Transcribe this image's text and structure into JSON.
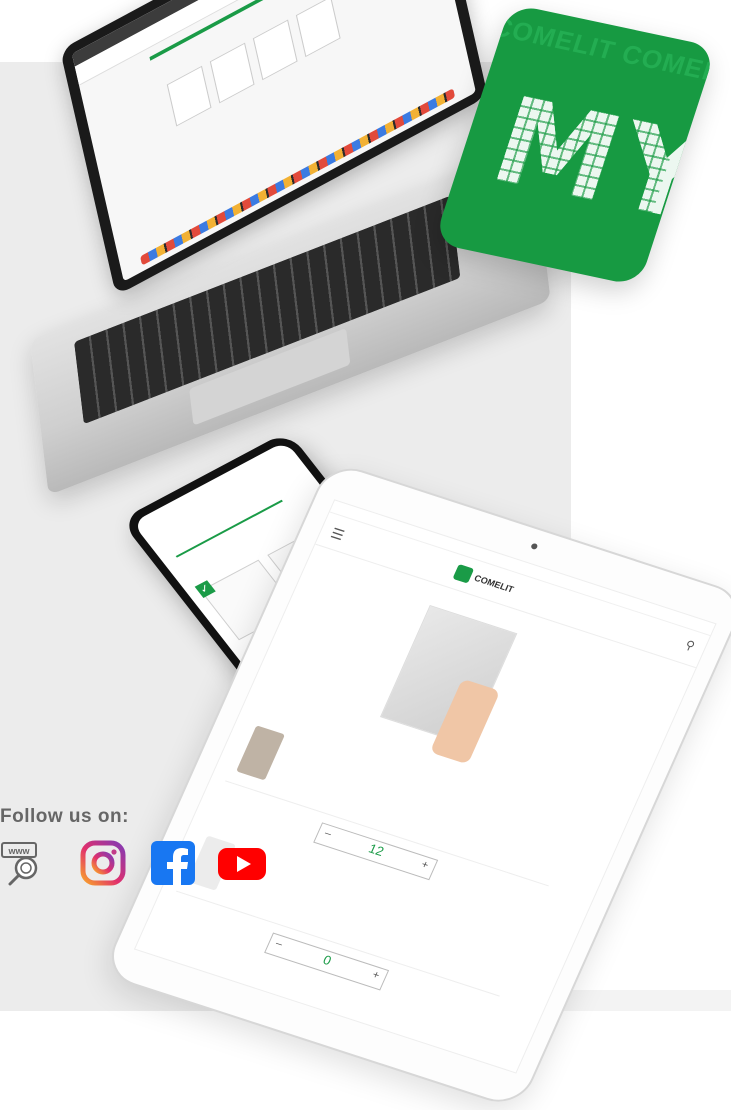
{
  "follow": {
    "title": "Follow us on:"
  },
  "social_icons": [
    "www-search-icon",
    "instagram-icon",
    "facebook-icon",
    "youtube-icon"
  ],
  "logo_card": {
    "letters": "MY",
    "watermark": "COMELIT COMELIT COMELIT COMELIT COMELIT"
  },
  "tablet": {
    "logo_text": "COMELIT",
    "quantities": [
      "12",
      "0"
    ]
  },
  "colors": {
    "brand_green": "#179a42",
    "panel_grey": "#ececec",
    "heading_grey": "#666666",
    "youtube_red": "#ff0000",
    "facebook_blue": "#1877f2"
  }
}
